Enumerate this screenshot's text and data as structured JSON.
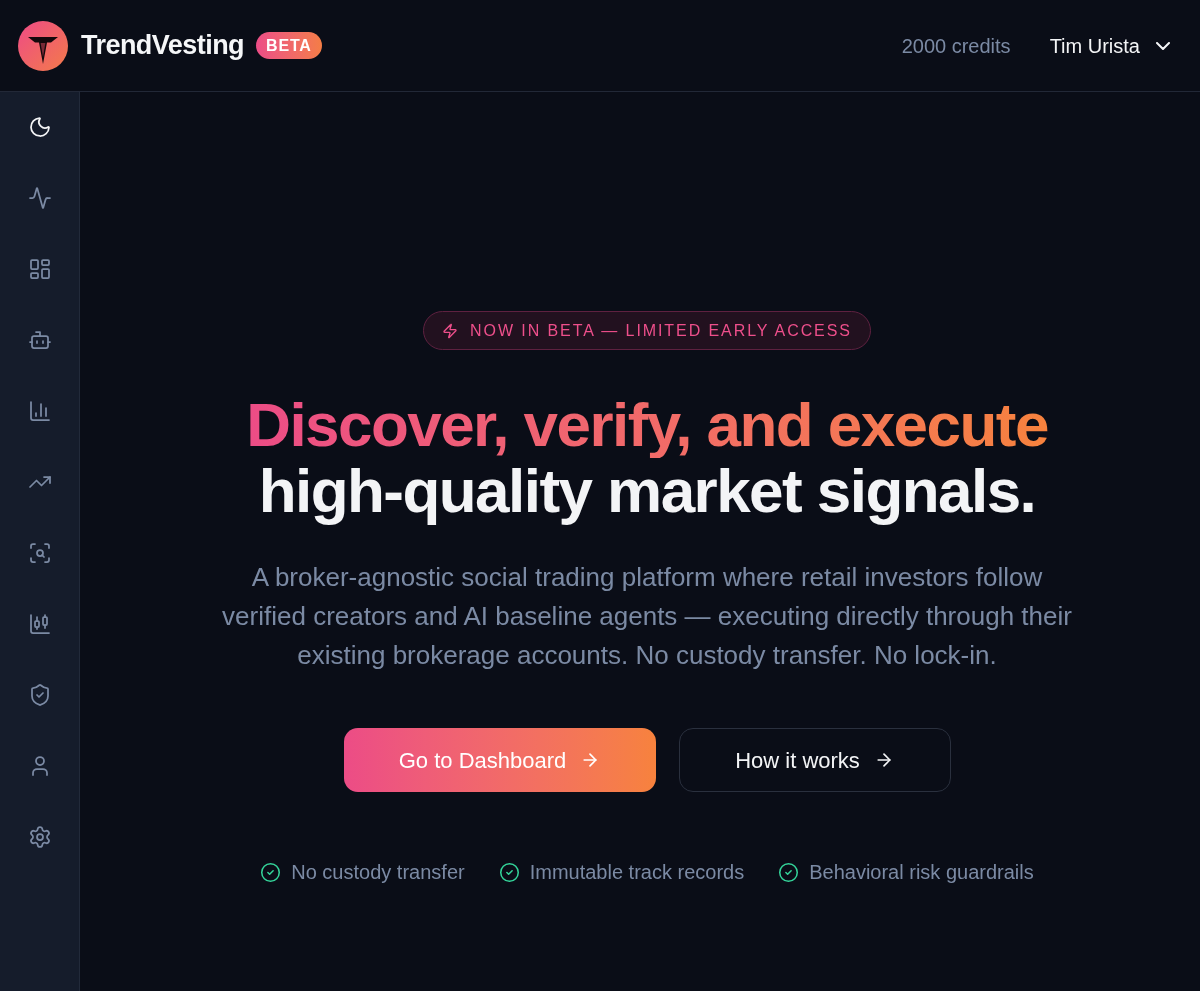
{
  "header": {
    "brand": "TrendVesting",
    "badge": "BETA",
    "credits": "2000 credits",
    "user": "Tim Urista"
  },
  "sidebar": {
    "items": [
      {
        "kind": "toggle"
      },
      {
        "kind": "link"
      },
      {
        "kind": "link"
      },
      {
        "kind": "link"
      },
      {
        "kind": "link"
      },
      {
        "kind": "link"
      },
      {
        "kind": "link"
      },
      {
        "kind": "link"
      },
      {
        "kind": "link"
      },
      {
        "kind": "link"
      },
      {
        "kind": "link"
      }
    ]
  },
  "hero": {
    "announcement": "NOW IN BETA — LIMITED EARLY ACCESS",
    "headline": {
      "accent": "Discover, verify, and execute",
      "main": "high-quality market signals."
    },
    "description": "A broker-agnostic social trading platform where retail investors follow verified creators and AI baseline agents — executing directly through their existing brokerage accounts. No custody transfer. No lock-in.",
    "buttons": [
      {
        "label": "Go to Dashboard",
        "kind": "primary"
      },
      {
        "label": "How it works",
        "kind": "secondary"
      }
    ],
    "features": [
      "No custody transfer",
      "Immutable track records",
      "Behavioral risk guardrails"
    ]
  }
}
